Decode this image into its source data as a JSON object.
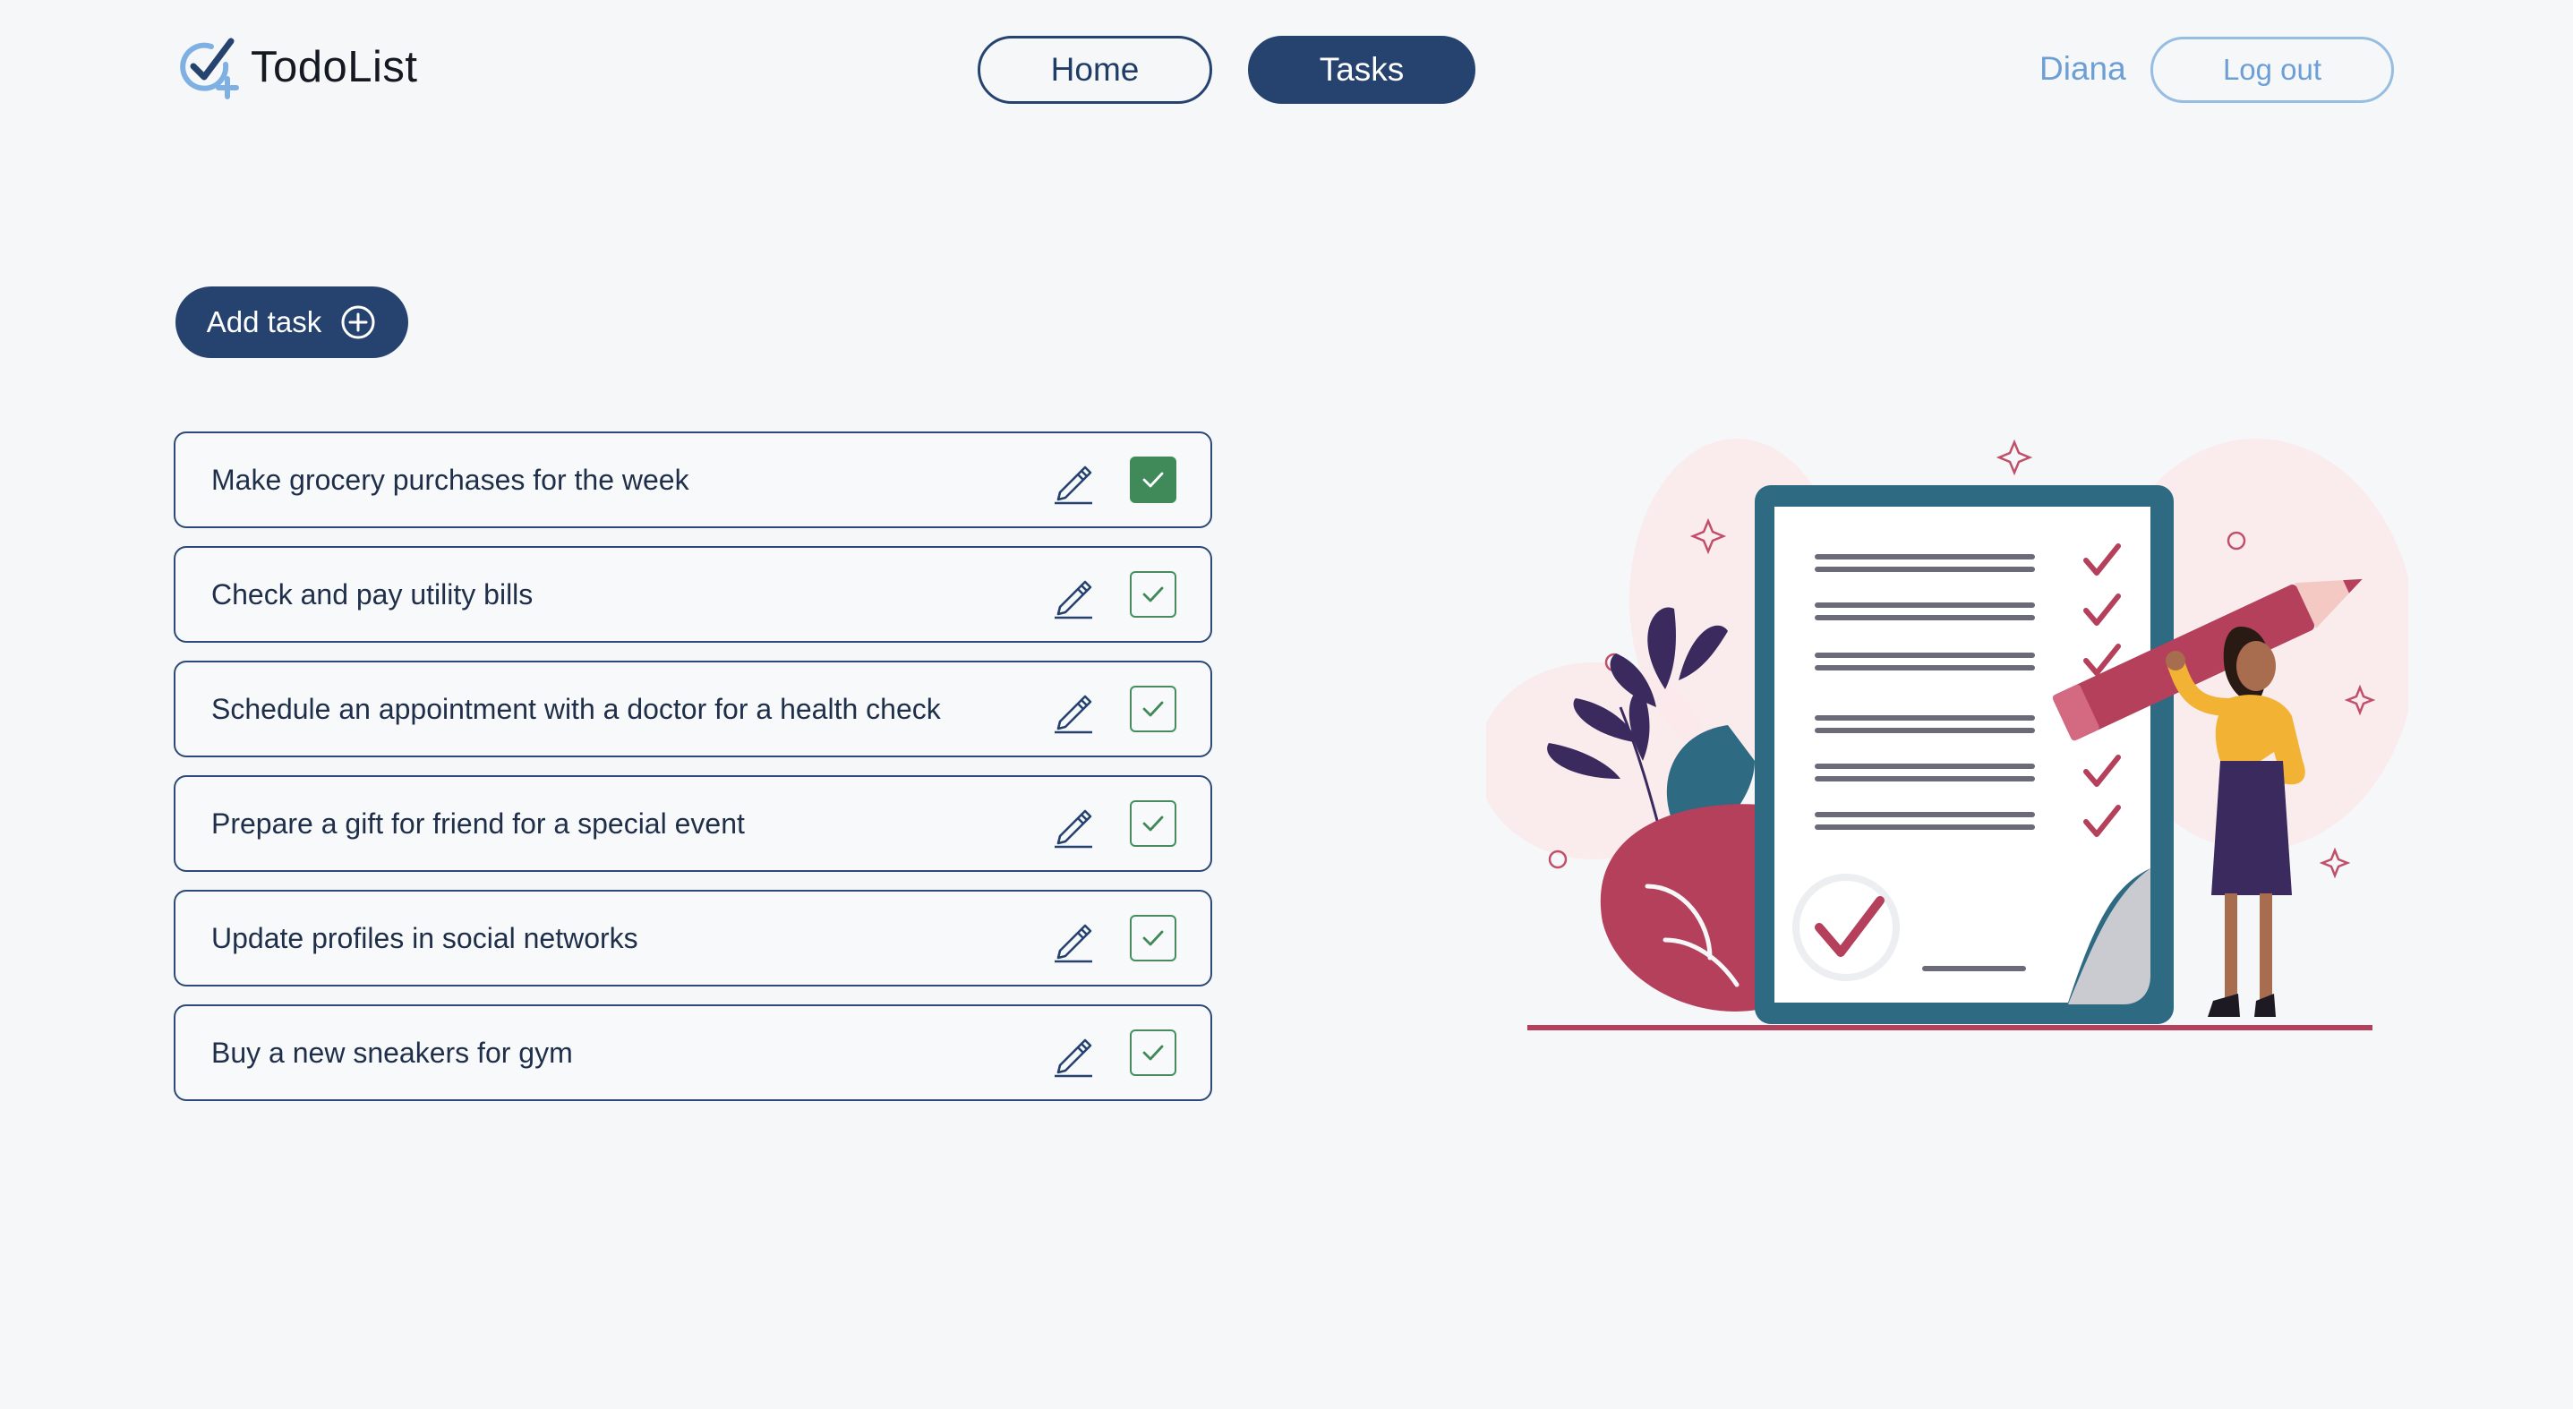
{
  "app": {
    "logo_text": "TodoList",
    "logo_icon": "check-circle-plus-icon"
  },
  "nav": {
    "home_label": "Home",
    "tasks_label": "Tasks",
    "active": "Tasks"
  },
  "user": {
    "name": "Diana",
    "logout_label": "Log out"
  },
  "actions": {
    "add_task_label": "Add task",
    "add_task_icon": "plus-circle-icon"
  },
  "tasks": [
    {
      "text": "Make grocery purchases for the week",
      "done": true
    },
    {
      "text": "Check and pay utility bills",
      "done": false
    },
    {
      "text": "Schedule an appointment with a doctor for a health check",
      "done": false
    },
    {
      "text": "Prepare a gift for friend for a special event",
      "done": false
    },
    {
      "text": "Update profiles in social networks",
      "done": false
    },
    {
      "text": "Buy a new sneakers for gym",
      "done": false
    }
  ],
  "colors": {
    "primary": "#26436f",
    "accent_light": "#6b9fd6",
    "success": "#3f8a58",
    "illustration_red": "#b5405b",
    "illustration_teal": "#2e6a82"
  }
}
